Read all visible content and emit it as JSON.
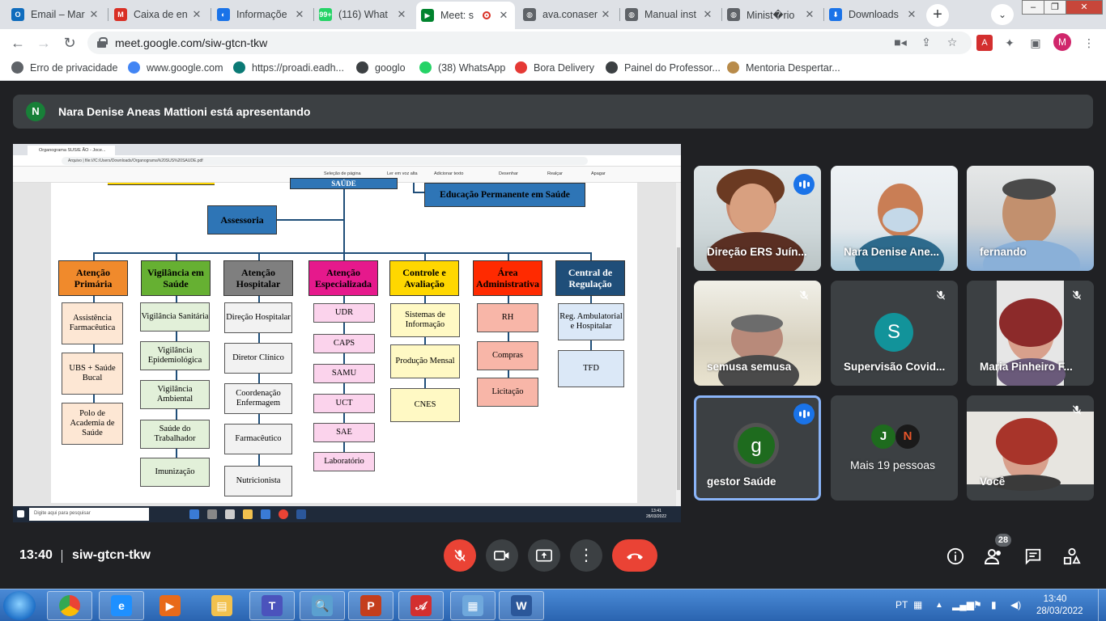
{
  "browser": {
    "tabs": [
      {
        "title": "Email – Mar",
        "icon": "outlook-icon",
        "color": "#0f6cbd",
        "glyph": "O"
      },
      {
        "title": "Caixa de en",
        "icon": "gmail-icon",
        "color": "#d93025",
        "glyph": "M"
      },
      {
        "title": "Informaçõe",
        "icon": "globe-icon",
        "color": "#1a73e8",
        "glyph": "◐"
      },
      {
        "title": "(116) What",
        "icon": "whatsapp-icon",
        "color": "#25d366",
        "glyph": "99+"
      },
      {
        "title": "Meet: s",
        "icon": "meet-icon",
        "color": "#00832d",
        "glyph": "▶"
      },
      {
        "title": "ava.conaser",
        "icon": "globe-icon",
        "color": "#5f6368",
        "glyph": "◍"
      },
      {
        "title": "Manual inst",
        "icon": "globe-icon",
        "color": "#5f6368",
        "glyph": "◍"
      },
      {
        "title": "Minist�rio",
        "icon": "globe-icon",
        "color": "#5f6368",
        "glyph": "◍"
      },
      {
        "title": "Downloads",
        "icon": "download-icon",
        "color": "#1a73e8",
        "glyph": "⬇"
      }
    ],
    "active_tab": 4,
    "url": "meet.google.com/siw-gtcn-tkw",
    "profile_initial": "M"
  },
  "bookmarks": [
    {
      "label": "Erro de privacidade",
      "icon": "warning-globe-icon",
      "color": "#5f6368"
    },
    {
      "label": "www.google.com",
      "icon": "google-icon",
      "color": "#4285f4"
    },
    {
      "label": "https://proadi.eadh...",
      "icon": "proadi-icon",
      "color": "#0b7a75"
    },
    {
      "label": "googlo",
      "icon": "globe-icon",
      "color": "#3c4043"
    },
    {
      "label": "(38) WhatsApp",
      "icon": "whatsapp-icon",
      "color": "#25d366"
    },
    {
      "label": "Bora Delivery",
      "icon": "bora-icon",
      "color": "#e53935"
    },
    {
      "label": "Painel do Professor...",
      "icon": "globe-icon",
      "color": "#3c4043"
    },
    {
      "label": "Mentoria Despertar...",
      "icon": "mentoria-icon",
      "color": "#b88b4a"
    }
  ],
  "meeting": {
    "presenter_initial": "N",
    "presenter_text": "Nara Denise Aneas Mattioni está apresentando",
    "time": "13:40",
    "code": "siw-gtcn-tkw",
    "participant_count": "28"
  },
  "shared_screen": {
    "tab_title": "Organograma SUS/E ÃO - Joce...",
    "url_text": "Arquivo | file:///C:/Users/Downloads/Organograma%20SUS%20SAUDE.pdf",
    "pdf_tools": [
      "Seleção de página",
      "Ler em voz alta",
      "Adicionar texto",
      "Desenhar",
      "Realçar",
      "Apagar"
    ],
    "search_placeholder": "Digite aqui para pesquisar",
    "clock_time": "13:41",
    "clock_date": "28/03/2022",
    "org": {
      "top_box": "SAÚDE",
      "assessoria": "Assessoria",
      "educacao": "Educação Permanente em Saúde",
      "departments": [
        {
          "title": "Atenção Primária",
          "color": "#f08a2c",
          "text_color": "#000",
          "child_color": "#fde7d4",
          "children": [
            "Assistência Farmacêutica",
            "UBS + Saúde Bucal",
            "Polo de Academia de Saúde"
          ]
        },
        {
          "title": "Vigilância em Saúde",
          "color": "#66b032",
          "text_color": "#000",
          "child_color": "#e2f0d9",
          "children": [
            "Vigilância Sanitária",
            "Vigilância Epidemiológica",
            "Vigilância Ambiental",
            "Saúde do Trabalhador",
            "Imunização"
          ]
        },
        {
          "title": "Atenção Hospitalar",
          "color": "#7f7f7f",
          "text_color": "#000",
          "child_color": "#f2f2f2",
          "children": [
            "Direção Hospitalar",
            "Diretor Clínico",
            "Coordenação Enfermagem",
            "Farmacêutico",
            "Nutricionista"
          ]
        },
        {
          "title": "Atenção Especializada",
          "color": "#e6198c",
          "text_color": "#000",
          "child_color": "#fbd3ec",
          "children": [
            "UDR",
            "CAPS",
            "SAMU",
            "UCT",
            "SAE",
            "Laboratório"
          ]
        },
        {
          "title": "Controle e Avaliação",
          "color": "#ffd700",
          "text_color": "#000",
          "child_color": "#fff9c4",
          "children": [
            "Sistemas de Informação",
            "Produção Mensal",
            "CNES"
          ]
        },
        {
          "title": "Área Administrativa",
          "color": "#ff2a00",
          "text_color": "#000",
          "child_color": "#f8b6a8",
          "children": [
            "RH",
            "Compras",
            "Licitação"
          ]
        },
        {
          "title": "Central de Regulação",
          "color": "#1f4e79",
          "text_color": "#fff",
          "child_color": "#dbe8f7",
          "children": [
            "Reg. Ambulatorial e Hospitalar",
            "TFD"
          ]
        }
      ]
    }
  },
  "participants": [
    {
      "name": "Direção ERS Juín...",
      "state": "talking"
    },
    {
      "name": "Nara Denise Ane...",
      "state": "none"
    },
    {
      "name": "fernando",
      "state": "none"
    },
    {
      "name": "semusa semusa",
      "state": "muted"
    },
    {
      "name": "Supervisão Covid...",
      "state": "muted",
      "initial": "S",
      "avatar_color": "#12939a"
    },
    {
      "name": "Maria Pinheiro F...",
      "state": "muted"
    },
    {
      "name": "gestor Saúde",
      "state": "talking",
      "initial": "g",
      "avatar_color": "#1e6b1e"
    },
    {
      "name": "Mais 19 pessoas",
      "state": "none",
      "mini": [
        "J",
        "N"
      ]
    },
    {
      "name": "Você",
      "state": "muted"
    }
  ],
  "taskbar": {
    "apps": [
      "chrome-icon",
      "ie-icon",
      "media-player-icon",
      "explorer-icon",
      "teams-icon",
      "magnifier-icon",
      "powerpoint-icon",
      "acrobat-icon",
      "network-icon",
      "word-icon"
    ],
    "lang": "PT",
    "time": "13:40",
    "date": "28/03/2022"
  }
}
